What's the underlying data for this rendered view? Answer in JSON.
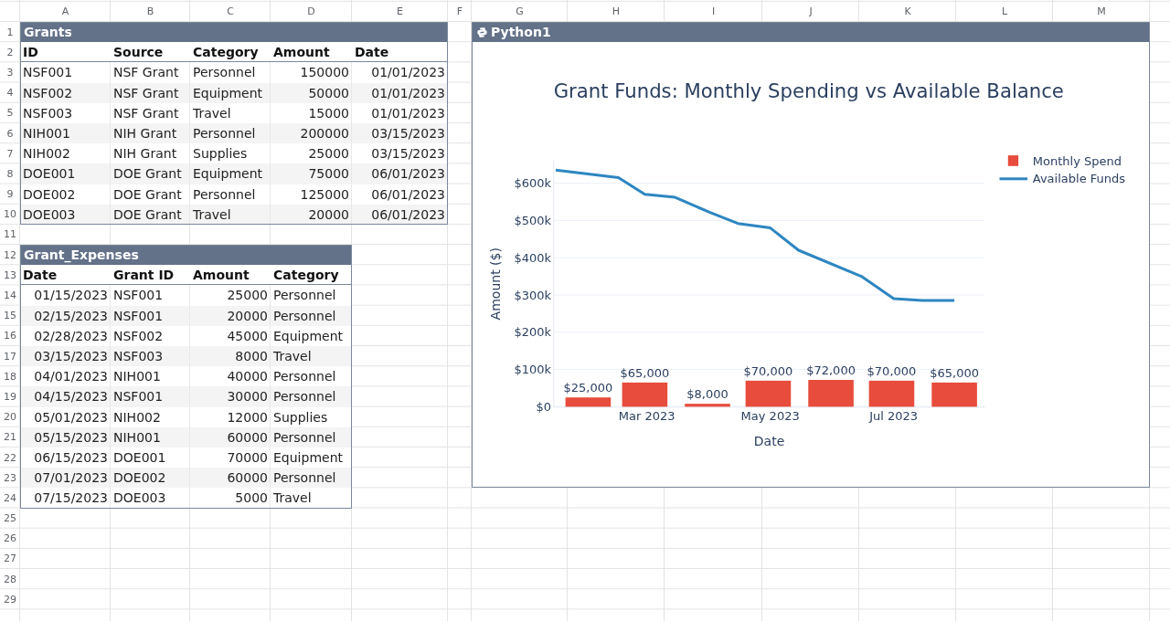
{
  "column_headers": [
    "A",
    "B",
    "C",
    "D",
    "E",
    "F",
    "G",
    "H",
    "I",
    "J",
    "K",
    "L",
    "M"
  ],
  "row_numbers": [
    "1",
    "2",
    "3",
    "4",
    "5",
    "6",
    "7",
    "8",
    "9",
    "10",
    "11",
    "12",
    "13",
    "14",
    "15",
    "16",
    "17",
    "18",
    "19",
    "20",
    "21",
    "22",
    "23",
    "24",
    "25",
    "26",
    "27",
    "28",
    "29"
  ],
  "tables": [
    {
      "title": "Grants",
      "columns": [
        {
          "label": "ID",
          "kind": "text"
        },
        {
          "label": "Source",
          "kind": "text"
        },
        {
          "label": "Category",
          "kind": "text"
        },
        {
          "label": "Amount",
          "kind": "number"
        },
        {
          "label": "Date",
          "kind": "date"
        }
      ],
      "rows": [
        [
          "NSF001",
          "NSF Grant",
          "Personnel",
          "150000",
          "01/01/2023"
        ],
        [
          "NSF002",
          "NSF Grant",
          "Equipment",
          "50000",
          "01/01/2023"
        ],
        [
          "NSF003",
          "NSF Grant",
          "Travel",
          "15000",
          "01/01/2023"
        ],
        [
          "NIH001",
          "NIH Grant",
          "Personnel",
          "200000",
          "03/15/2023"
        ],
        [
          "NIH002",
          "NIH Grant",
          "Supplies",
          "25000",
          "03/15/2023"
        ],
        [
          "DOE001",
          "DOE Grant",
          "Equipment",
          "75000",
          "06/01/2023"
        ],
        [
          "DOE002",
          "DOE Grant",
          "Personnel",
          "125000",
          "06/01/2023"
        ],
        [
          "DOE003",
          "DOE Grant",
          "Travel",
          "20000",
          "06/01/2023"
        ]
      ]
    },
    {
      "title": "Grant_Expenses",
      "columns": [
        {
          "label": "Date",
          "kind": "date"
        },
        {
          "label": "Grant ID",
          "kind": "text"
        },
        {
          "label": "Amount",
          "kind": "number"
        },
        {
          "label": "Category",
          "kind": "text"
        }
      ],
      "rows": [
        [
          "01/15/2023",
          "NSF001",
          "25000",
          "Personnel"
        ],
        [
          "02/15/2023",
          "NSF001",
          "20000",
          "Personnel"
        ],
        [
          "02/28/2023",
          "NSF002",
          "45000",
          "Equipment"
        ],
        [
          "03/15/2023",
          "NSF003",
          "8000",
          "Travel"
        ],
        [
          "04/01/2023",
          "NIH001",
          "40000",
          "Personnel"
        ],
        [
          "04/15/2023",
          "NSF001",
          "30000",
          "Personnel"
        ],
        [
          "05/01/2023",
          "NIH002",
          "12000",
          "Supplies"
        ],
        [
          "05/15/2023",
          "NIH001",
          "60000",
          "Personnel"
        ],
        [
          "06/15/2023",
          "DOE001",
          "70000",
          "Equipment"
        ],
        [
          "07/01/2023",
          "DOE002",
          "60000",
          "Personnel"
        ],
        [
          "07/15/2023",
          "DOE003",
          "5000",
          "Travel"
        ]
      ]
    }
  ],
  "python_cell": {
    "title": "Python1",
    "chart_data": {
      "type": "bar",
      "title": "Grant Funds: Monthly Spending vs Available Balance",
      "xlabel": "Date",
      "ylabel": "Amount ($)",
      "legend": "right",
      "grid": true,
      "xlim": [
        "2023-01-14",
        "2023-08-15"
      ],
      "ylim": [
        0,
        660000
      ],
      "xticks": [
        {
          "value": "2023-03-01",
          "label": "Mar 2023"
        },
        {
          "value": "2023-05-01",
          "label": "May 2023"
        },
        {
          "value": "2023-07-01",
          "label": "Jul 2023"
        }
      ],
      "yticks": [
        {
          "value": 0,
          "label": "$0"
        },
        {
          "value": 100000,
          "label": "$100k"
        },
        {
          "value": 200000,
          "label": "$200k"
        },
        {
          "value": 300000,
          "label": "$300k"
        },
        {
          "value": 400000,
          "label": "$400k"
        },
        {
          "value": 500000,
          "label": "$500k"
        },
        {
          "value": 600000,
          "label": "$600k"
        }
      ],
      "series": [
        {
          "name": "Monthly Spend",
          "color": "#e74c3c",
          "x": [
            "2023-01-31",
            "2023-02-28",
            "2023-03-31",
            "2023-04-30",
            "2023-05-31",
            "2023-06-30",
            "2023-07-31"
          ],
          "values": [
            25000,
            65000,
            8000,
            70000,
            72000,
            70000,
            65000
          ],
          "value_labels": [
            "$25,000",
            "$65,000",
            "$8,000",
            "$70,000",
            "$72,000",
            "$70,000",
            "$65,000"
          ]
        },
        {
          "name": "Available Funds",
          "type": "line",
          "color": "#2e86c1",
          "x": [
            "2023-01-15",
            "2023-02-15",
            "2023-02-28",
            "2023-03-15",
            "2023-04-01",
            "2023-04-15",
            "2023-05-01",
            "2023-05-15",
            "2023-06-15",
            "2023-07-01",
            "2023-07-15",
            "2023-07-31"
          ],
          "values": [
            635000,
            615000,
            570000,
            562000,
            522000,
            492000,
            480000,
            420000,
            350000,
            290000,
            285000,
            285000
          ]
        }
      ]
    }
  }
}
